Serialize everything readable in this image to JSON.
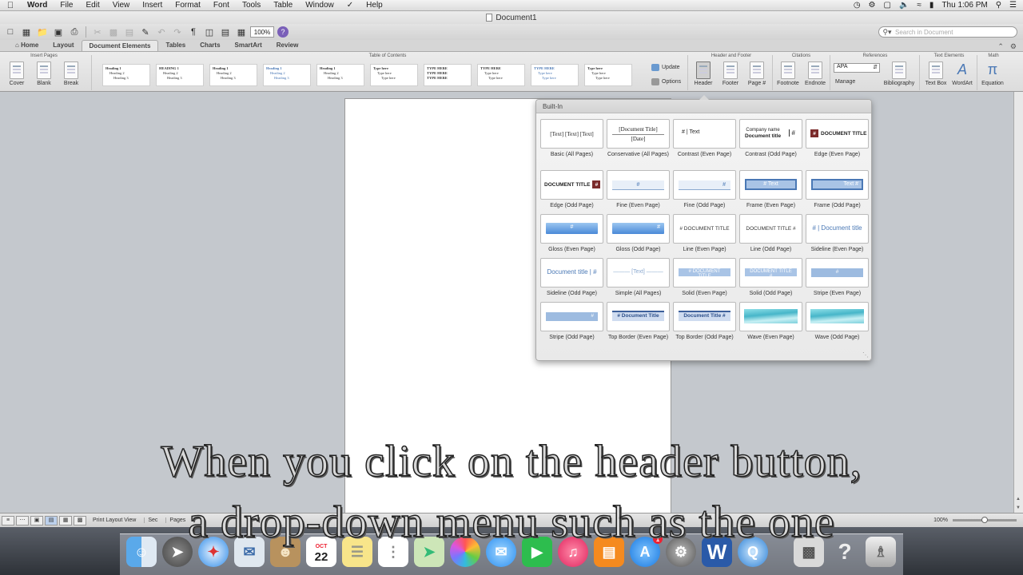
{
  "menubar": {
    "app": "Word",
    "items": [
      "File",
      "Edit",
      "View",
      "Insert",
      "Format",
      "Font",
      "Tools",
      "Table",
      "Window",
      "Help"
    ],
    "clock": "Thu 1:06 PM"
  },
  "window": {
    "title": "Document1"
  },
  "toolbar": {
    "zoom": "100%"
  },
  "search": {
    "placeholder": "Search in Document"
  },
  "ribbon": {
    "tabs": [
      "Home",
      "Layout",
      "Document Elements",
      "Tables",
      "Charts",
      "SmartArt",
      "Review"
    ],
    "active_tab": "Document Elements",
    "groups": {
      "insert_pages": "Insert Pages",
      "toc": "Table of Contents",
      "header_footer": "Header and Footer",
      "citations": "Citations",
      "references": "References",
      "text_elements": "Text Elements",
      "math": "Math"
    },
    "buttons": {
      "cover": "Cover",
      "blank": "Blank",
      "break": "Break",
      "update": "Update",
      "options": "Options",
      "header": "Header",
      "footer": "Footer",
      "page_num": "Page #",
      "footnote": "Footnote",
      "endnote": "Endnote",
      "citation_style": "APA",
      "manage": "Manage",
      "bibliography": "Bibliography",
      "text_box": "Text Box",
      "wordart": "WordArt",
      "equation": "Equation"
    },
    "toc_styles": [
      [
        "Heading 1",
        "Heading 2",
        "Heading 3"
      ],
      [
        "HEADING 1",
        "Heading 2",
        "Heading 3"
      ],
      [
        "Heading 1",
        "Heading 2",
        "Heading 3"
      ],
      [
        "Heading 1",
        "Heading 2",
        "Heading 3"
      ],
      [
        "Heading 1",
        "Heading 2",
        "Heading 3"
      ],
      [
        "Type here",
        "Type here",
        "Type here"
      ],
      [
        "TYPE HERE",
        "TYPE HERE",
        "TYPE HERE"
      ],
      [
        "TYPE HERE",
        "Type here",
        "Type here"
      ],
      [
        "TYPE HERE",
        "Type here",
        "Type here"
      ],
      [
        "Type here",
        "Type here",
        "Type here"
      ]
    ]
  },
  "gallery": {
    "title": "Built-In",
    "items": [
      {
        "label": "Basic (All Pages)",
        "preview": "[Text]   [Text]   [Text]"
      },
      {
        "label": "Conservative (All Pages)",
        "preview": "[Document Title]",
        "preview2": "[Date]"
      },
      {
        "label": "Contrast (Even Page)",
        "preview": "# | Text"
      },
      {
        "label": "Contrast (Odd Page)",
        "preview": "Company name",
        "preview2": "Document title"
      },
      {
        "label": "Edge (Even Page)",
        "preview": "DOCUMENT TITLE"
      },
      {
        "label": "Edge (Odd Page)",
        "preview": "DOCUMENT TITLE"
      },
      {
        "label": "Fine (Even Page)",
        "preview": "#"
      },
      {
        "label": "Fine (Odd Page)",
        "preview": "#"
      },
      {
        "label": "Frame (Even Page)",
        "preview": "#  Text"
      },
      {
        "label": "Frame (Odd Page)",
        "preview": "Text  #"
      },
      {
        "label": "Gloss (Even Page)",
        "preview": "#"
      },
      {
        "label": "Gloss (Odd Page)",
        "preview": "#"
      },
      {
        "label": "Line (Even Page)",
        "preview": "#  DOCUMENT TITLE"
      },
      {
        "label": "Line (Odd Page)",
        "preview": "DOCUMENT TITLE  #"
      },
      {
        "label": "Sideline (Even Page)",
        "preview": "# | Document title"
      },
      {
        "label": "Sideline (Odd Page)",
        "preview": "Document title | #"
      },
      {
        "label": "Simple (All Pages)",
        "preview": "——— [Text] ———"
      },
      {
        "label": "Solid (Even Page)",
        "preview": "#  DOCUMENT TITLE"
      },
      {
        "label": "Solid (Odd Page)",
        "preview": "DOCUMENT TITLE  #"
      },
      {
        "label": "Stripe (Even Page)",
        "preview": "#"
      },
      {
        "label": "Stripe (Odd Page)",
        "preview": "#"
      },
      {
        "label": "Top Border (Even Page)",
        "preview": "#  Document Title"
      },
      {
        "label": "Top Border (Odd Page)",
        "preview": "Document Title  #"
      },
      {
        "label": "Wave (Even Page)",
        "preview": ""
      },
      {
        "label": "Wave (Odd Page)",
        "preview": ""
      }
    ]
  },
  "statusbar": {
    "view": "Print Layout View",
    "sec": "Sec",
    "pages": "Pages",
    "zoom": "100%"
  },
  "dock": {
    "calendar_month": "OCT",
    "calendar_day": "22",
    "appstore_badge": "1",
    "icons": [
      "finder-icon",
      "launchpad-icon",
      "safari-icon",
      "mail-icon",
      "contacts-icon",
      "calendar-icon",
      "notes-icon",
      "reminders-icon",
      "maps-icon",
      "photos-icon",
      "messages-icon",
      "facetime-icon",
      "itunes-icon",
      "ibooks-icon",
      "app-store-icon",
      "system-preferences-icon",
      "word-icon",
      "quicktime-icon",
      "scanner-icon",
      "help-icon",
      "trash-icon"
    ]
  },
  "caption": {
    "line1": "When you click on the header button,",
    "line2": "a drop-down menu such as the one"
  },
  "colors": {
    "accent": "#4a78b5",
    "edge": "#7b2b2b",
    "ribbon": "#e2e2e2"
  }
}
